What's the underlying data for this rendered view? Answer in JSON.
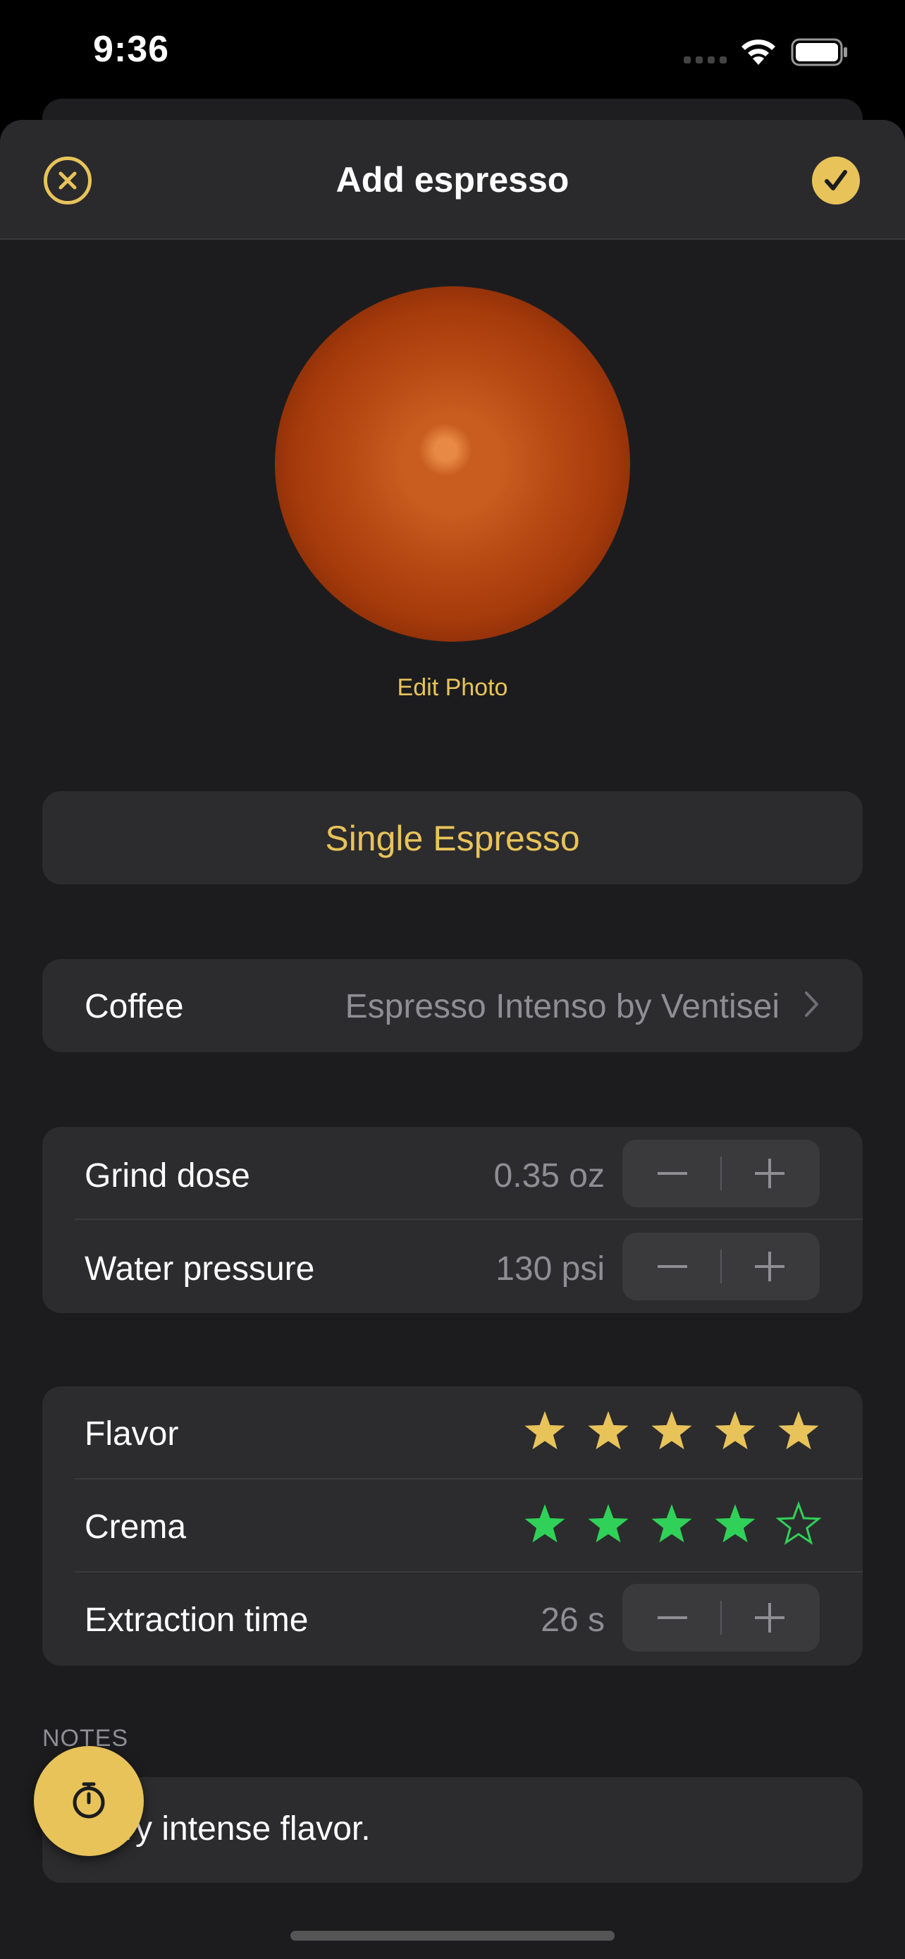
{
  "status_bar": {
    "time": "9:36"
  },
  "nav": {
    "title": "Add espresso"
  },
  "photo": {
    "edit_label": "Edit Photo"
  },
  "drink": {
    "name": "Single Espresso"
  },
  "coffee": {
    "label": "Coffee",
    "value": "Espresso Intenso by Ventisei"
  },
  "dose": {
    "grind_label": "Grind dose",
    "grind_value": "0.35 oz",
    "pressure_label": "Water pressure",
    "pressure_value": "130 psi"
  },
  "rating": {
    "flavor_label": "Flavor",
    "flavor_stars": 5,
    "flavor_color": "#e8c35a",
    "crema_label": "Crema",
    "crema_stars": 4,
    "crema_color": "#30d158",
    "extraction_label": "Extraction time",
    "extraction_value": "26 s"
  },
  "notes": {
    "header": "NOTES",
    "text": "Very intense flavor."
  },
  "colors": {
    "accent": "#e8c35a",
    "background": "#1c1c1e",
    "card": "#2c2c2e"
  }
}
